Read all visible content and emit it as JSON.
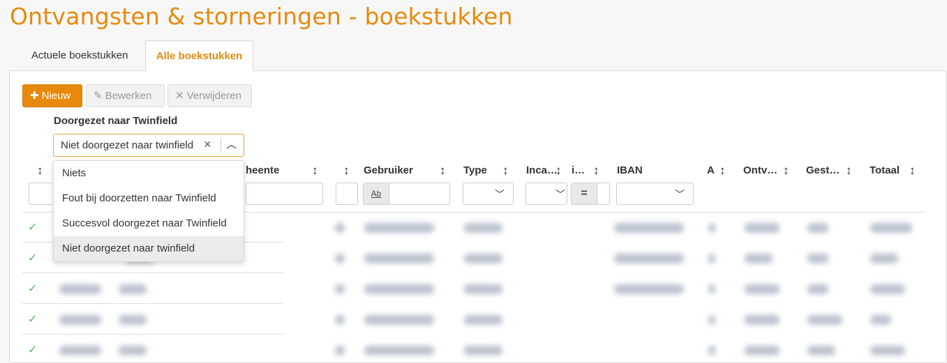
{
  "page": {
    "title": "Ontvangsten & storneringen - boekstukken"
  },
  "tabs": [
    {
      "label": "Actuele boekstukken",
      "active": false
    },
    {
      "label": "Alle boekstukken",
      "active": true
    }
  ],
  "toolbar": {
    "new_label": "Nieuw",
    "edit_label": "Bewerken",
    "delete_label": "Verwijderen"
  },
  "filter": {
    "label": "Doorgezet naar Twinfield",
    "selected": "Niet doorgezet naar twinfield",
    "options": [
      "Niets",
      "Fout bij doorzetten naar Twinfield",
      "Succesvol doorgezet naar Twinfield",
      "Niet doorgezet naar twinfield"
    ]
  },
  "columns": {
    "col2": "heente",
    "gebruiker": "Gebruiker",
    "type": "Type",
    "incasso": "Inca…",
    "col_i": "i…",
    "iban": "IBAN",
    "col_a": "A",
    "ontvangen": "Ontv…",
    "gestorneerd": "Gest…",
    "totaal": "Totaal"
  },
  "filter_inputs": {
    "text_prefix": "Ab",
    "equals_prefix": "="
  },
  "icons": {
    "sort": "sort-vertical-icon",
    "check": "check-icon",
    "plus": "plus-icon",
    "edit": "edit-icon",
    "close": "close-icon",
    "chevron_up": "chevron-up-icon",
    "chevron_down": "chevron-down-icon"
  },
  "colors": {
    "accent": "#e8890c",
    "success": "#5cb85c",
    "disabled": "#999999"
  }
}
